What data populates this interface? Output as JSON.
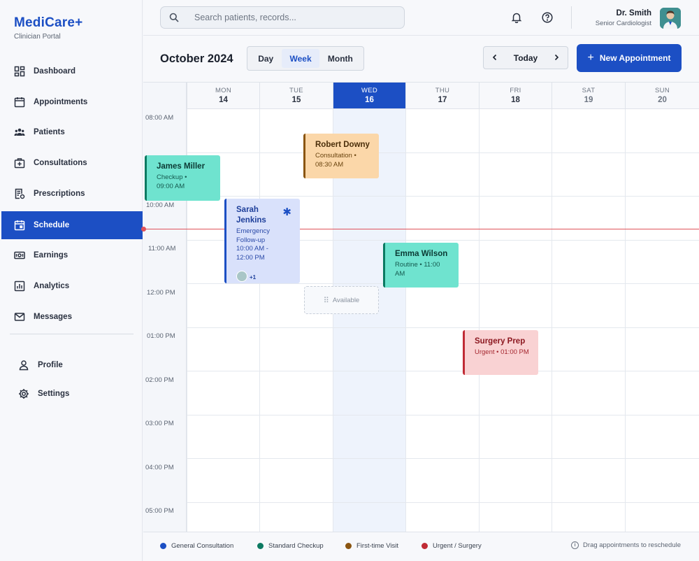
{
  "app": {
    "name": "MediCare+",
    "subtitle": "Clinician Portal"
  },
  "sidebar": {
    "items": [
      {
        "label": "Dashboard",
        "icon": "grid-icon"
      },
      {
        "label": "Appointments",
        "icon": "calendar-icon"
      },
      {
        "label": "Patients",
        "icon": "users-icon"
      },
      {
        "label": "Consultations",
        "icon": "medical-case-icon"
      },
      {
        "label": "Prescriptions",
        "icon": "prescription-icon"
      },
      {
        "label": "Schedule",
        "icon": "calendar-today-icon",
        "active": true
      },
      {
        "label": "Earnings",
        "icon": "money-icon"
      },
      {
        "label": "Analytics",
        "icon": "chart-icon"
      },
      {
        "label": "Messages",
        "icon": "mail-icon"
      }
    ],
    "bottom": [
      {
        "label": "Profile",
        "icon": "person-icon"
      },
      {
        "label": "Settings",
        "icon": "gear-icon"
      }
    ]
  },
  "topbar": {
    "search_placeholder": "Search patients, records...",
    "user_name": "Dr. Smith",
    "user_role": "Senior Cardiologist"
  },
  "calendar": {
    "month_title": "October 2024",
    "views": [
      "Day",
      "Week",
      "Month"
    ],
    "active_view": "Week",
    "today_label": "Today",
    "new_button": "New Appointment",
    "days": [
      {
        "name": "MON",
        "num": "14"
      },
      {
        "name": "TUE",
        "num": "15"
      },
      {
        "name": "WED",
        "num": "16",
        "active": true
      },
      {
        "name": "THU",
        "num": "17"
      },
      {
        "name": "FRI",
        "num": "18"
      },
      {
        "name": "SAT",
        "num": "19"
      },
      {
        "name": "SUN",
        "num": "20"
      }
    ],
    "times": [
      "08:00 AM",
      "10:00 AM",
      "11:00 AM",
      "12:00 PM",
      "01:00 PM",
      "02:00 PM",
      "03:00 PM",
      "04:00 PM",
      "05:00 PM"
    ],
    "events": [
      {
        "title": "James Miller",
        "sub": "Checkup •\n09:00 AM"
      },
      {
        "title": "Robert Downy",
        "sub": "Consultation •\n08:30 AM"
      },
      {
        "title": "Sarah Jenkins",
        "sub": "Emergency Follow-up\n10:00 AM - 12:00 PM",
        "extra": "+1"
      },
      {
        "title": "Emma Wilson",
        "sub": "Routine • 11:00 AM"
      },
      {
        "title": "Surgery Prep",
        "sub": "Urgent • 01:00 PM"
      }
    ],
    "available_label": "Available"
  },
  "legend": {
    "items": [
      {
        "label": "General Consultation",
        "color": "#1c4fc4"
      },
      {
        "label": "Standard Checkup",
        "color": "#0c7a62"
      },
      {
        "label": "First-time Visit",
        "color": "#8a5511"
      },
      {
        "label": "Urgent / Surgery",
        "color": "#c02b35"
      }
    ],
    "hint": "Drag appointments to reschedule"
  }
}
